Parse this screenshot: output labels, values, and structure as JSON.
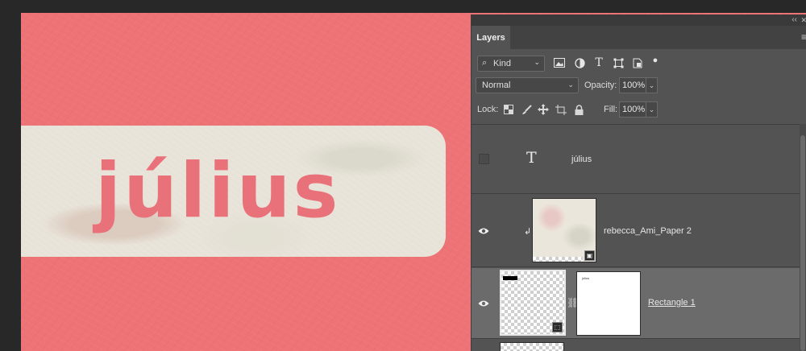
{
  "canvas": {
    "label_text": "július"
  },
  "panel": {
    "collapse_glyph": "‹‹",
    "close_glyph": "✕",
    "tab": "Layers",
    "filter": {
      "kind": "Kind"
    },
    "blend_mode": "Normal",
    "opacity_label": "Opacity:",
    "opacity_value": "100%",
    "lock_label": "Lock:",
    "fill_label": "Fill:",
    "fill_value": "100%",
    "layers": [
      {
        "name": "július",
        "type": "text",
        "visible": false
      },
      {
        "name": "rebecca_Ami_Paper 2",
        "type": "smart-object",
        "visible": true,
        "clipped": true
      },
      {
        "name": "Rectangle 1",
        "type": "shape",
        "visible": true,
        "selected": true,
        "mask_thumb_text": "július"
      }
    ]
  },
  "colors": {
    "canvas_bg": "#ed7377",
    "label_text": "#e9727a",
    "panel_bg": "#535353",
    "selected_row": "#6b6b6b"
  }
}
